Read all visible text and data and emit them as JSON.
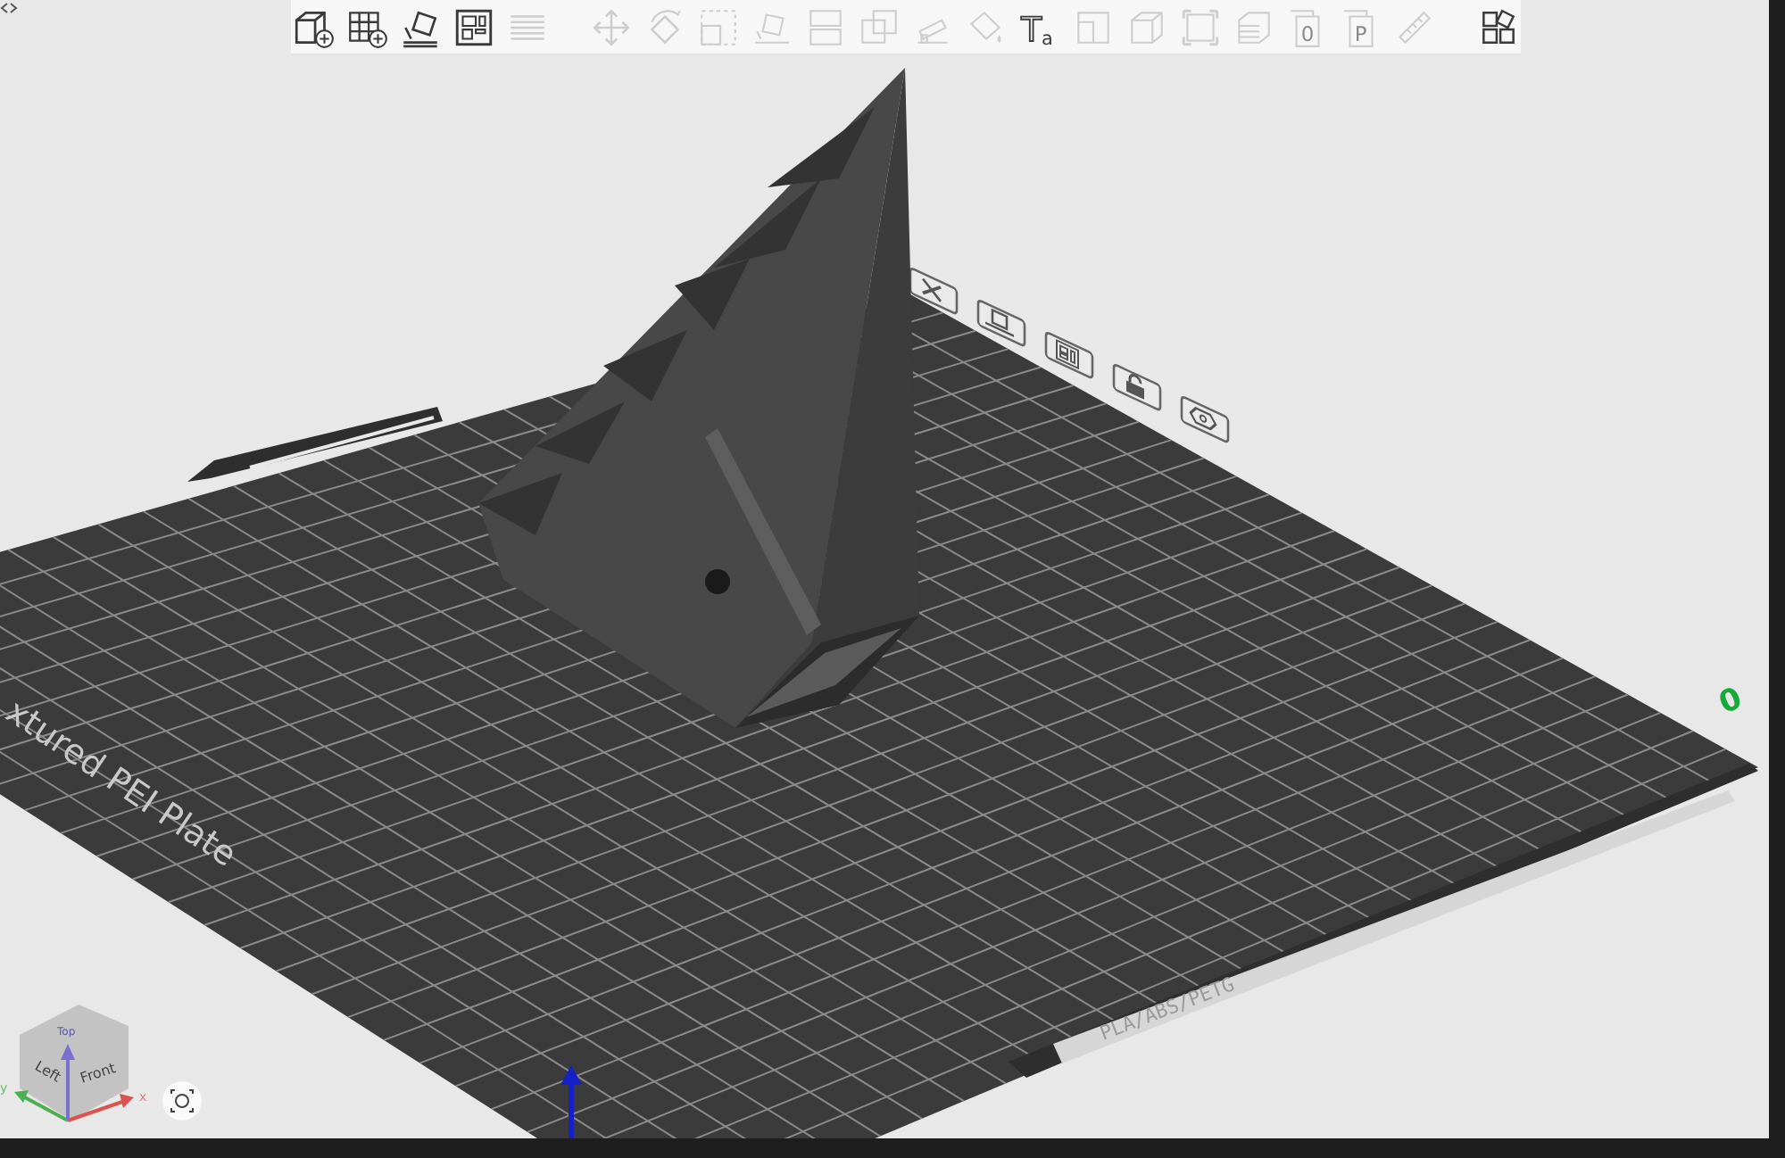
{
  "toolbar": {
    "groups": [
      [
        {
          "kind": "add-object",
          "disabled": false
        },
        {
          "kind": "add-plate",
          "disabled": false
        },
        {
          "kind": "auto-orient",
          "disabled": false
        },
        {
          "kind": "arrange",
          "disabled": false
        },
        {
          "kind": "layers",
          "disabled": true
        }
      ],
      [
        {
          "kind": "move",
          "disabled": true
        },
        {
          "kind": "rotate",
          "disabled": true
        },
        {
          "kind": "scale",
          "disabled": true
        },
        {
          "kind": "lay-on-face",
          "disabled": true
        },
        {
          "kind": "split",
          "disabled": true
        },
        {
          "kind": "boolean",
          "disabled": true
        },
        {
          "kind": "support",
          "disabled": true
        },
        {
          "kind": "paint",
          "disabled": true
        },
        {
          "kind": "text",
          "glyph": "Ta",
          "disabled": false
        },
        {
          "kind": "seam",
          "disabled": true
        },
        {
          "kind": "cube",
          "disabled": true
        },
        {
          "kind": "fit",
          "disabled": true
        },
        {
          "kind": "stack",
          "disabled": true
        },
        {
          "kind": "sheet",
          "glyph": "0",
          "disabled": true
        },
        {
          "kind": "sheet",
          "glyph": "P",
          "disabled": true
        },
        {
          "kind": "measure",
          "disabled": true
        }
      ],
      [
        {
          "kind": "assembly",
          "disabled": false
        }
      ]
    ]
  },
  "plate": {
    "name": "xtured PEI Plate",
    "filament": "PLA/ABS/PETG",
    "number": "0",
    "buttons": [
      {
        "kind": "close"
      },
      {
        "kind": "orient"
      },
      {
        "kind": "arrange"
      },
      {
        "kind": "lock"
      },
      {
        "kind": "settings"
      }
    ]
  },
  "view_cube": {
    "faces": [
      "Top",
      "Left",
      "Front"
    ],
    "axes": [
      "x",
      "y"
    ]
  }
}
